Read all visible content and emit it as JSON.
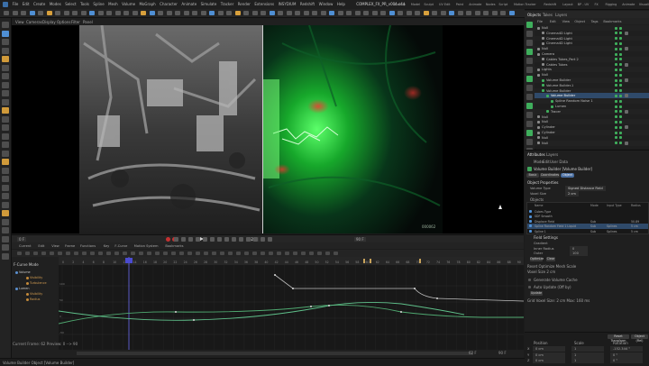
{
  "menu": {
    "items": [
      "File",
      "Edit",
      "Create",
      "Modes",
      "Select",
      "Tools",
      "Spline",
      "Mesh",
      "Volume",
      "MoGraph",
      "Character",
      "Animate",
      "Simulate",
      "Tracker",
      "Render",
      "Extensions",
      "INSYDIUM",
      "Redshift",
      "Window",
      "Help"
    ],
    "window_title": "COMPLEX_FX_PR_v004.c4d",
    "layout_tabs": [
      "Startup",
      "Model",
      "Sculpt",
      "UV Edit",
      "Paint",
      "Animate",
      "Nodes",
      "Script",
      "Motion Tracker",
      "Redshift",
      "Layout",
      "BP - UV",
      "FX",
      "Rigging",
      "Animate",
      "Visualize"
    ]
  },
  "viewport": {
    "menu": [
      "View",
      "Cameras",
      "Display",
      "Options",
      "Filter",
      "Panel"
    ],
    "frame_counter": "000062"
  },
  "transport": {
    "frame_start": "0 F",
    "frame_current": "62 F",
    "frame_end": "90 F"
  },
  "timeline": {
    "menu": [
      "Current",
      "Edit",
      "View",
      "Frame",
      "Functions",
      "Key",
      "F-Curve",
      "Motion System",
      "Bookmarks"
    ],
    "mode_label": "F-Curve Mode",
    "tracks": [
      {
        "name": "Volume",
        "type": "object"
      },
      {
        "name": "Visibility",
        "type": "param"
      },
      {
        "name": "Turbulence",
        "type": "param"
      },
      {
        "name": "Lumen",
        "type": "object"
      },
      {
        "name": "Visibility",
        "type": "param"
      },
      {
        "name": "Radius",
        "type": "param"
      }
    ],
    "ruler_ticks": [
      "0",
      "2",
      "4",
      "6",
      "8",
      "10",
      "12",
      "14",
      "16",
      "18",
      "20",
      "22",
      "24",
      "26",
      "28",
      "30",
      "32",
      "34",
      "36",
      "38",
      "40",
      "42",
      "44",
      "46",
      "48",
      "50",
      "52",
      "54",
      "56",
      "58",
      "60",
      "62",
      "64",
      "66",
      "68",
      "70",
      "72",
      "74",
      "76",
      "78",
      "80",
      "82",
      "84",
      "86",
      "88",
      "90"
    ],
    "value_ticks": [
      "100",
      "50",
      "0",
      "-50"
    ],
    "status": "Current Frame: 62  Preview: 0 --> 90",
    "bottom_right_a": "62 F",
    "bottom_right_b": "90 F"
  },
  "status_bar": {
    "text": "Volume Builder Object [Volume Builder]"
  },
  "right_tabs": [
    "Objects",
    "Takes",
    "Layers"
  ],
  "object_manager": {
    "menu": [
      "File",
      "Edit",
      "View",
      "Object",
      "Tags",
      "Bookmarks"
    ],
    "rows": [
      {
        "name": "Null",
        "indent": 0
      },
      {
        "name": "Cinema4D Light",
        "indent": 1
      },
      {
        "name": "Cinema4D Light",
        "indent": 1
      },
      {
        "name": "Cinema4D Light",
        "indent": 1
      },
      {
        "name": "Null",
        "indent": 0
      },
      {
        "name": "Camera",
        "indent": 0
      },
      {
        "name": "Cables Tubes_Part 2",
        "indent": 1
      },
      {
        "name": "Cables Tubes",
        "indent": 1
      },
      {
        "name": "Lights",
        "indent": 0
      },
      {
        "name": "Null",
        "indent": 0
      },
      {
        "name": "Volume Builder",
        "indent": 1
      },
      {
        "name": "Volume Builder.1",
        "indent": 1
      },
      {
        "name": "Volume Builder",
        "indent": 1
      },
      {
        "name": "Volume Builder",
        "indent": 2
      },
      {
        "name": "Spline Random Noise 1",
        "indent": 3
      },
      {
        "name": "Lumen",
        "indent": 3
      },
      {
        "name": "Tracer",
        "indent": 2
      },
      {
        "name": "Null",
        "indent": 0
      },
      {
        "name": "Null",
        "indent": 0
      },
      {
        "name": "Cylinder",
        "indent": 0
      },
      {
        "name": "Cylinder",
        "indent": 0
      },
      {
        "name": "Null",
        "indent": 0
      },
      {
        "name": "Null",
        "indent": 0
      }
    ]
  },
  "attributes": {
    "tabs": [
      "Attributes",
      "Layers"
    ],
    "menu": [
      "Mode",
      "Edit",
      "User Data"
    ],
    "object_title": "Volume Builder [Volume Builder]",
    "sub_tabs": [
      "Basic",
      "Coordinates",
      "Object"
    ],
    "section": "Object Properties",
    "props": [
      {
        "label": "Volume Type",
        "value": "Signed Distance Field"
      },
      {
        "label": "Voxel Size",
        "value": "2 cm"
      }
    ],
    "objects_label": "Objects",
    "list_headers": [
      "Name",
      "Mode",
      "Input Type",
      "Radius"
    ],
    "list_rows": [
      {
        "name": "Cubes Type",
        "mode": "",
        "type": "",
        "radius": ""
      },
      {
        "name": "SDF Smooth",
        "mode": "",
        "type": "",
        "radius": ""
      },
      {
        "name": "Displace Field",
        "mode": "Sub",
        "type": "",
        "radius": "50.89"
      },
      {
        "name": "Spline Random Field 1 Liquid",
        "mode": "Sub",
        "type": "Splines",
        "radius": "5 cm"
      },
      {
        "name": "Spline 1",
        "mode": "Sub",
        "type": "Splines",
        "radius": "5 cm"
      }
    ],
    "field_settings": "Field Settings",
    "settings_rows": [
      {
        "label": "Gradient",
        "value": ""
      },
      {
        "label": "Inner Radius",
        "value": "0"
      },
      {
        "label": "Outer",
        "value": "100"
      }
    ],
    "buttons": [
      "Optimize",
      "Clear"
    ],
    "mesh_label": "Reset Optimize Mesh Scale",
    "voxel_line": "Voxel Size 2 cm",
    "checkbox1": "Generate Volume Cache",
    "checkbox2": "Auto Update (Off by)",
    "update_btn": "Update",
    "info_line": "Grid Voxel Size: 2 cm   Max: 160 ms"
  },
  "coordinates": {
    "headers": [
      "Position",
      "Scale",
      "Rotation"
    ],
    "rows": [
      {
        "axis": "X",
        "pos": "0 cm",
        "scale": "1",
        "rot": "-152.344 °"
      },
      {
        "axis": "Y",
        "pos": "0 cm",
        "scale": "1",
        "rot": "0 °"
      },
      {
        "axis": "Z",
        "pos": "0 cm",
        "scale": "1",
        "rot": "0 °"
      }
    ],
    "buttons": [
      "Reset Transform",
      "Object (Rel)"
    ]
  }
}
